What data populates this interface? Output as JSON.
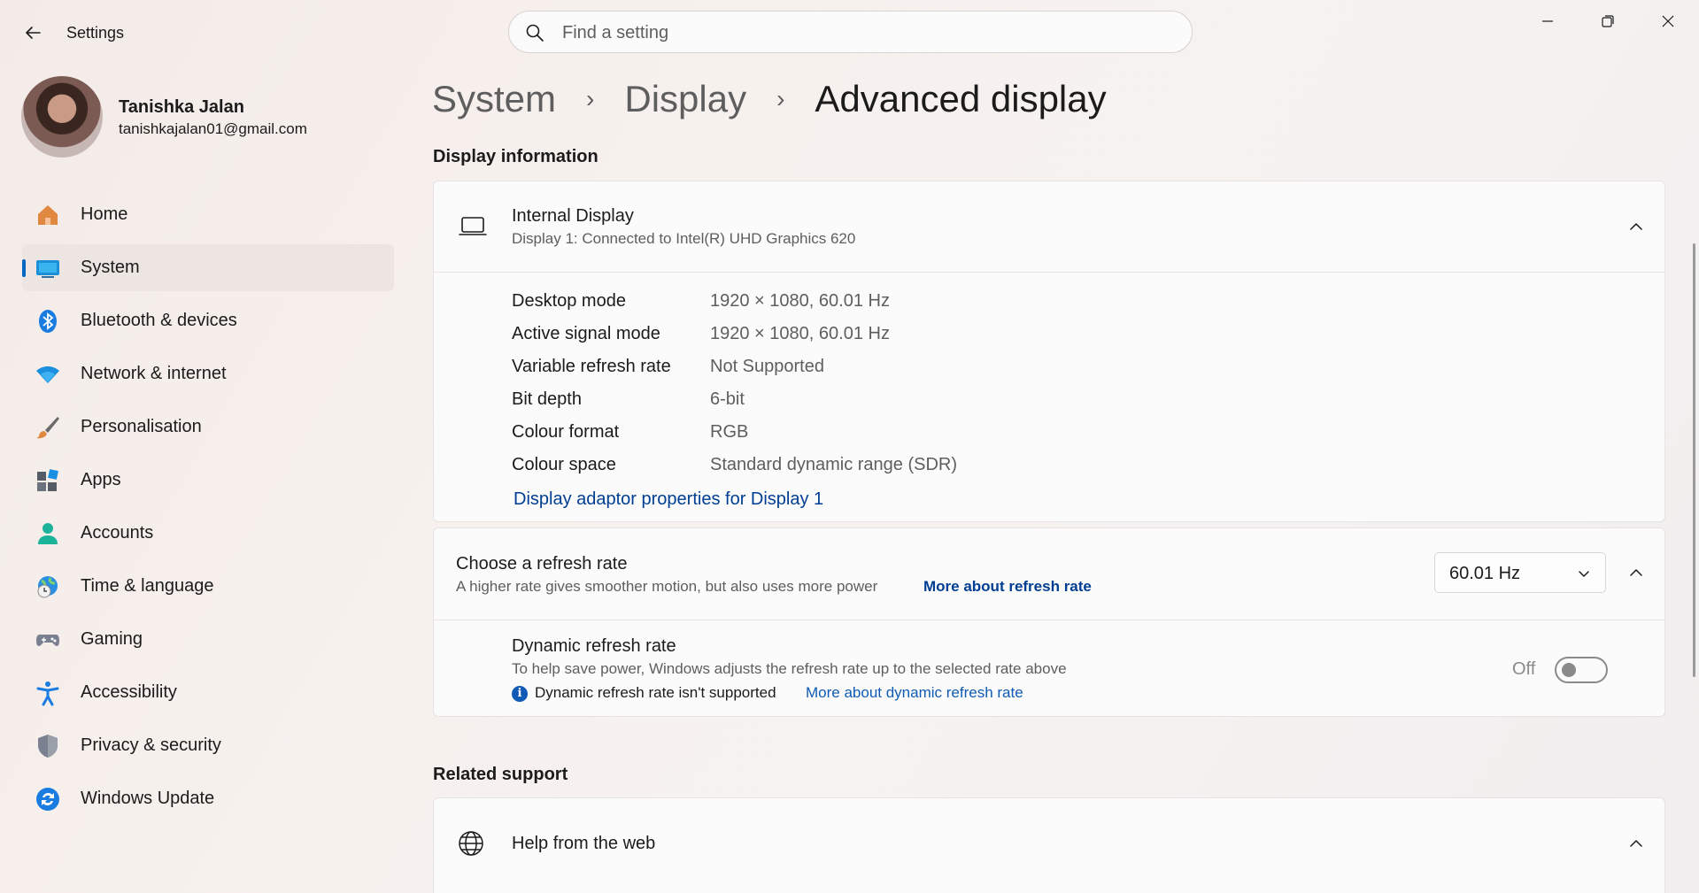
{
  "app": {
    "title": "Settings"
  },
  "search": {
    "placeholder": "Find a setting"
  },
  "profile": {
    "name": "Tanishka Jalan",
    "email": "tanishkajalan01@gmail.com"
  },
  "sidebar": {
    "items": [
      {
        "label": "Home",
        "icon": "home-icon"
      },
      {
        "label": "System",
        "icon": "system-icon",
        "active": true
      },
      {
        "label": "Bluetooth & devices",
        "icon": "bluetooth-icon"
      },
      {
        "label": "Network & internet",
        "icon": "wifi-icon"
      },
      {
        "label": "Personalisation",
        "icon": "brush-icon"
      },
      {
        "label": "Apps",
        "icon": "apps-icon"
      },
      {
        "label": "Accounts",
        "icon": "accounts-icon"
      },
      {
        "label": "Time & language",
        "icon": "globe-clock-icon"
      },
      {
        "label": "Gaming",
        "icon": "gamepad-icon"
      },
      {
        "label": "Accessibility",
        "icon": "accessibility-icon"
      },
      {
        "label": "Privacy & security",
        "icon": "shield-icon"
      },
      {
        "label": "Windows Update",
        "icon": "update-icon"
      }
    ]
  },
  "breadcrumb": {
    "items": [
      "System",
      "Display"
    ],
    "current": "Advanced display"
  },
  "display_info": {
    "section_title": "Display information",
    "display_name": "Internal Display",
    "display_subtitle": "Display 1: Connected to Intel(R) UHD Graphics 620",
    "rows": [
      {
        "label": "Desktop mode",
        "value": "1920 × 1080, 60.01 Hz"
      },
      {
        "label": "Active signal mode",
        "value": "1920 × 1080, 60.01 Hz"
      },
      {
        "label": "Variable refresh rate",
        "value": "Not Supported"
      },
      {
        "label": "Bit depth",
        "value": "6-bit"
      },
      {
        "label": "Colour format",
        "value": "RGB"
      },
      {
        "label": "Colour space",
        "value": "Standard dynamic range (SDR)"
      }
    ],
    "adapter_link": "Display adaptor properties for Display 1"
  },
  "refresh_rate": {
    "title": "Choose a refresh rate",
    "subtitle": "A higher rate gives smoother motion, but also uses more power",
    "more_link": "More about refresh rate",
    "selected": "60.01 Hz",
    "dynamic": {
      "title": "Dynamic refresh rate",
      "subtitle": "To help save power, Windows adjusts the refresh rate up to the selected rate above",
      "note": "Dynamic refresh rate isn't supported",
      "more_link": "More about dynamic refresh rate",
      "toggle_state": "Off"
    }
  },
  "related_support": {
    "section_title": "Related support",
    "help_title": "Help from the web"
  },
  "colors": {
    "accent": "#0067c0",
    "link": "#003e92"
  }
}
